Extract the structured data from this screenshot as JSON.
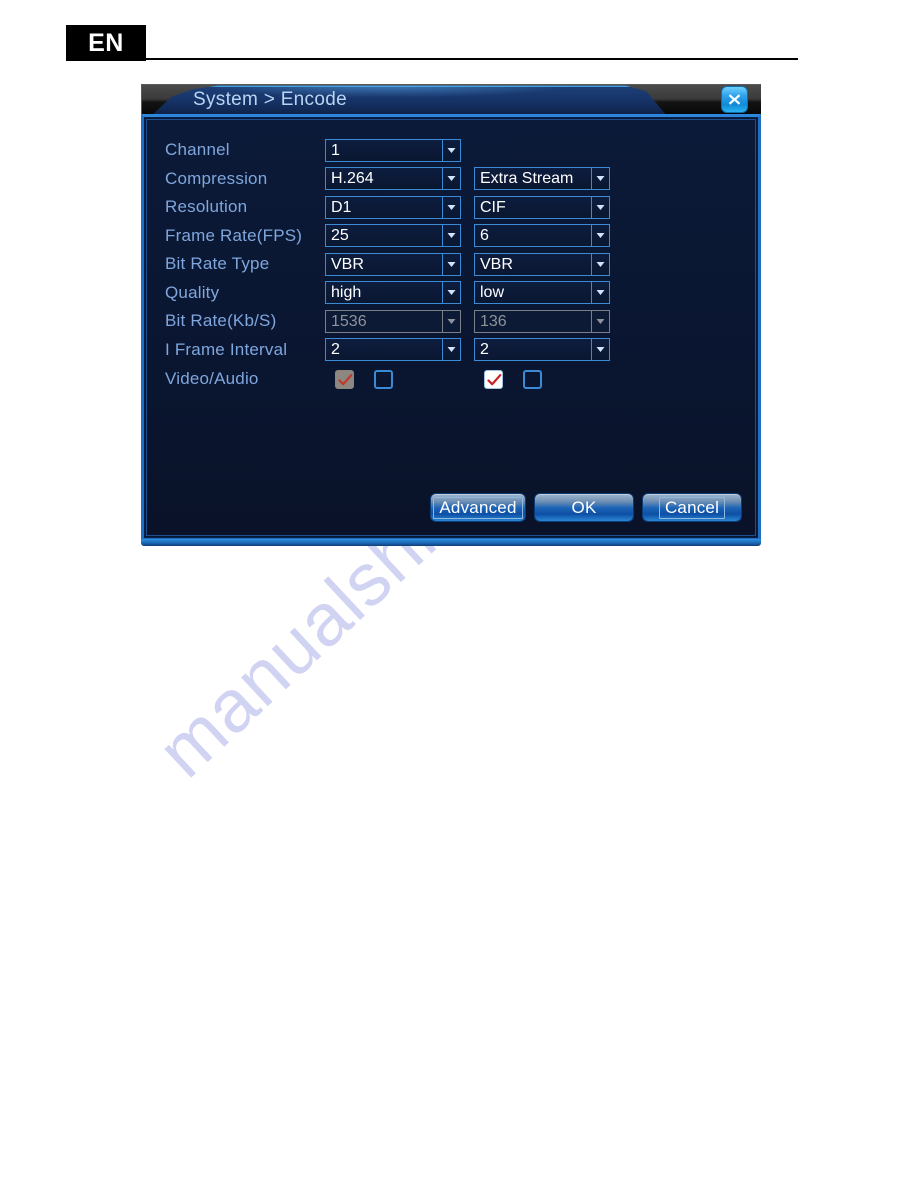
{
  "page": {
    "language_badge": "EN",
    "watermark": "manualshive.com"
  },
  "dialog": {
    "title": "System > Encode",
    "close_icon": "close-x-icon",
    "accent_color": "#3a8ad6",
    "background_color": "#0a1733",
    "label_color": "#7fa6dd",
    "disabled_color": "#8e929b",
    "check_color": "#cc2020"
  },
  "form": {
    "rows": [
      {
        "label": "Channel",
        "main": {
          "value": "1",
          "disabled": false
        },
        "extra": null
      },
      {
        "label": "Compression",
        "main": {
          "value": "H.264",
          "disabled": false
        },
        "extra": {
          "value": "Extra Stream",
          "disabled": false
        }
      },
      {
        "label": "Resolution",
        "main": {
          "value": "D1",
          "disabled": false
        },
        "extra": {
          "value": "CIF",
          "disabled": false
        }
      },
      {
        "label": "Frame Rate(FPS)",
        "main": {
          "value": "25",
          "disabled": false
        },
        "extra": {
          "value": "6",
          "disabled": false
        }
      },
      {
        "label": "Bit Rate Type",
        "main": {
          "value": "VBR",
          "disabled": false
        },
        "extra": {
          "value": "VBR",
          "disabled": false
        }
      },
      {
        "label": "Quality",
        "main": {
          "value": "high",
          "disabled": false
        },
        "extra": {
          "value": "low",
          "disabled": false
        }
      },
      {
        "label": "Bit Rate(Kb/S)",
        "main": {
          "value": "1536",
          "disabled": true
        },
        "extra": {
          "value": "136",
          "disabled": true
        }
      },
      {
        "label": "I Frame Interval",
        "main": {
          "value": "2",
          "disabled": false
        },
        "extra": {
          "value": "2",
          "disabled": false
        }
      }
    ],
    "video_audio": {
      "label": "Video/Audio",
      "main_video": {
        "checked": true,
        "style": "gray"
      },
      "main_audio": {
        "checked": false,
        "style": "empty"
      },
      "extra_video": {
        "checked": true,
        "style": "white"
      },
      "extra_audio": {
        "checked": false,
        "style": "empty"
      }
    }
  },
  "buttons": {
    "advanced": "Advanced",
    "ok": "OK",
    "cancel": "Cancel"
  }
}
